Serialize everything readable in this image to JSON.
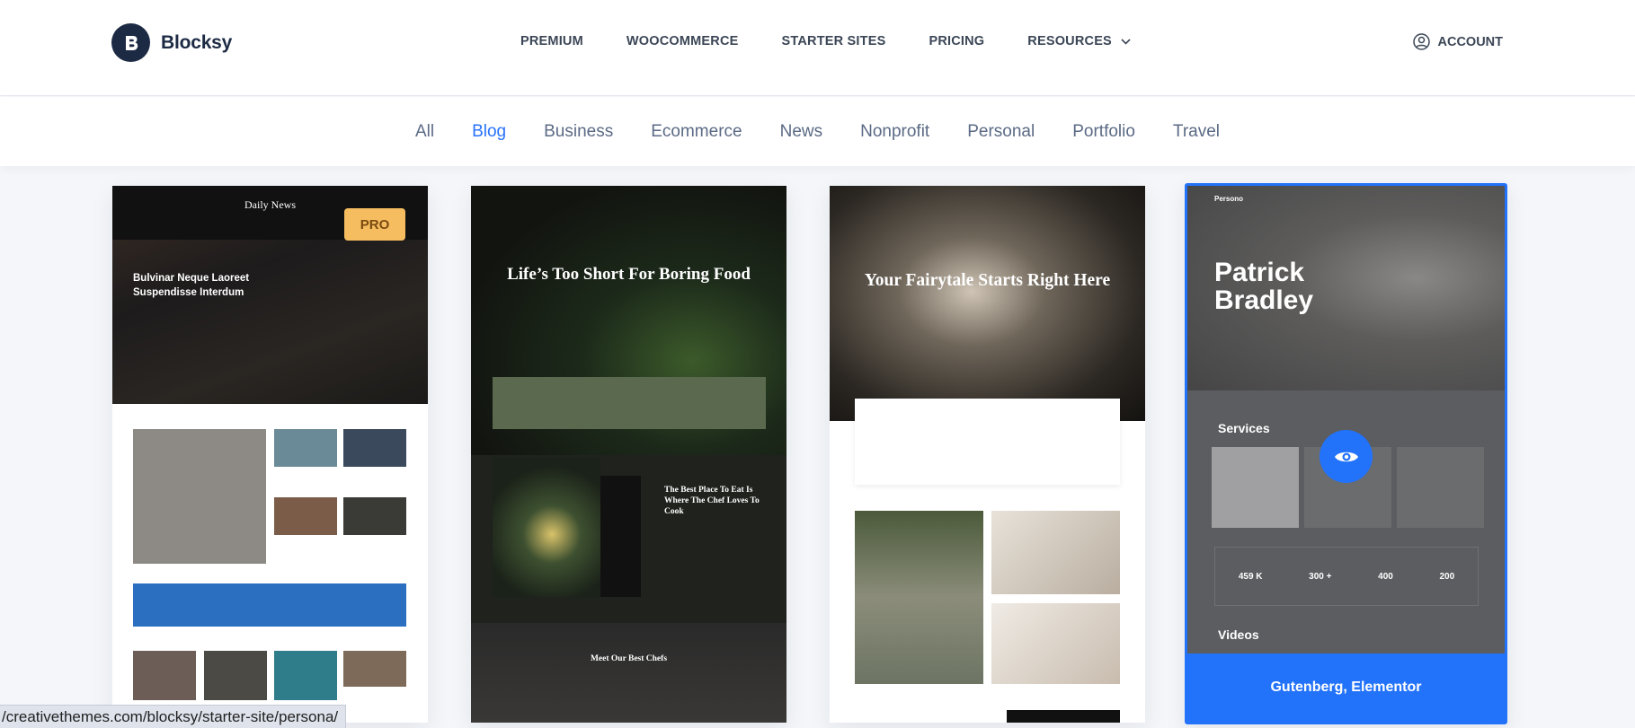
{
  "header": {
    "logo_text": "Blocksy",
    "nav": [
      {
        "label": "PREMIUM"
      },
      {
        "label": "WOOCOMMERCE"
      },
      {
        "label": "STARTER SITES"
      },
      {
        "label": "PRICING"
      },
      {
        "label": "RESOURCES",
        "has_dropdown": true
      }
    ],
    "account_label": "ACCOUNT"
  },
  "filters": {
    "items": [
      "All",
      "Blog",
      "Business",
      "Ecommerce",
      "News",
      "Nonprofit",
      "Personal",
      "Portfolio",
      "Travel"
    ],
    "active": "Blog"
  },
  "cards": [
    {
      "masthead": "Daily News",
      "badge": "PRO",
      "headline": "Bulvinar Neque Laoreet Suspendisse Interdum"
    },
    {
      "title": "Life’s Too Short For Boring Food",
      "feature_text": "The Best Place To Eat Is Where The Chef Loves To Cook",
      "section_title": "Meet Our Best Chefs"
    },
    {
      "title": "Your Fairytale Starts Right Here"
    },
    {
      "brand": "Persono",
      "name_line1": "Patrick",
      "name_line2": "Bradley",
      "services_title": "Services",
      "stats": [
        {
          "value": "459 K"
        },
        {
          "value": "300 +"
        },
        {
          "value": "400"
        },
        {
          "value": "200"
        }
      ],
      "videos_title": "Videos",
      "footer_label": "Gutenberg, Elementor"
    }
  ],
  "status_bar": {
    "url": "/creativethemes.com/blocksy/starter-site/persona/"
  },
  "colors": {
    "accent": "#2272fa",
    "pro_badge": "#f6bd60",
    "nav_text": "#3b4656",
    "filter_text": "#5b6a85"
  }
}
